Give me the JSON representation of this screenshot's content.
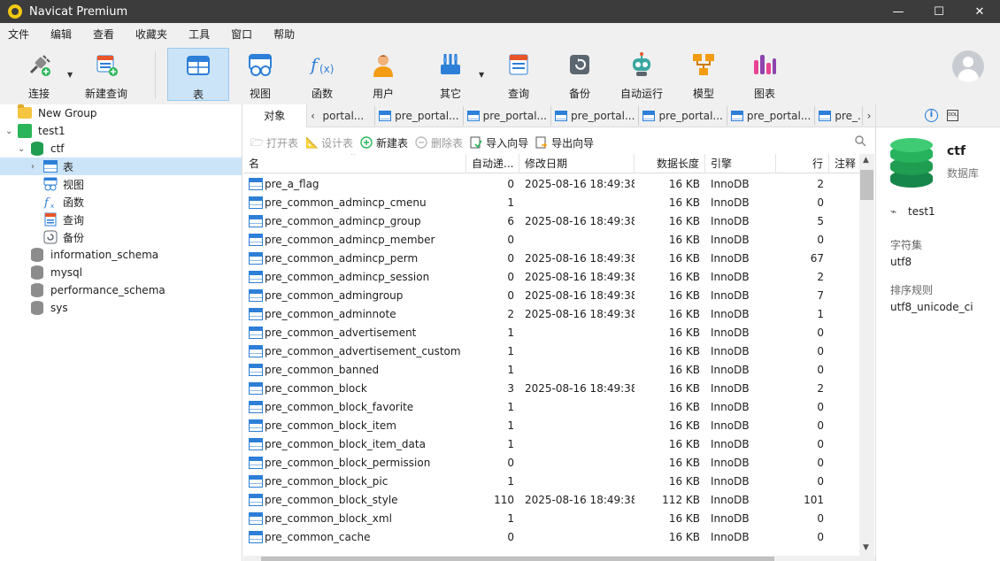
{
  "window": {
    "title": "Navicat Premium",
    "minimize": "—",
    "maximize": "☐",
    "close": "✕"
  },
  "menu": [
    "文件",
    "编辑",
    "查看",
    "收藏夹",
    "工具",
    "窗口",
    "帮助"
  ],
  "toolbar": {
    "connect": "连接",
    "new_query": "新建查询",
    "table": "表",
    "view": "视图",
    "function": "函数",
    "user": "用户",
    "other": "其它",
    "query": "查询",
    "backup": "备份",
    "automation": "自动运行",
    "model": "模型",
    "chart": "图表"
  },
  "sidebar": {
    "group": "New Group",
    "connection": "test1",
    "database": "ctf",
    "db_children": [
      "表",
      "视图",
      "函数",
      "查询",
      "备份"
    ],
    "other_dbs": [
      "information_schema",
      "mysql",
      "performance_schema",
      "sys"
    ]
  },
  "tabs": {
    "object_tab": "对象",
    "open_tabs": [
      "portal...",
      "pre_portal...",
      "pre_portal...",
      "pre_portal...",
      "pre_portal...",
      "pre_portal...",
      "pre_..."
    ]
  },
  "actions": {
    "open_table": "打开表",
    "design_table": "设计表",
    "new_table": "新建表",
    "delete_table": "删除表",
    "import_wizard": "导入向导",
    "export_wizard": "导出向导"
  },
  "table": {
    "headers": [
      "名",
      "自动递...",
      "修改日期",
      "数据长度",
      "引擎",
      "行",
      "注释"
    ],
    "rows": [
      [
        "pre_a_flag",
        "0",
        "2025-08-16 18:49:38",
        "16 KB",
        "InnoDB",
        "2"
      ],
      [
        "pre_common_admincp_cmenu",
        "1",
        "",
        "16 KB",
        "InnoDB",
        "0"
      ],
      [
        "pre_common_admincp_group",
        "6",
        "2025-08-16 18:49:38",
        "16 KB",
        "InnoDB",
        "5"
      ],
      [
        "pre_common_admincp_member",
        "0",
        "",
        "16 KB",
        "InnoDB",
        "0"
      ],
      [
        "pre_common_admincp_perm",
        "0",
        "2025-08-16 18:49:38",
        "16 KB",
        "InnoDB",
        "67"
      ],
      [
        "pre_common_admincp_session",
        "0",
        "2025-08-16 18:49:38",
        "16 KB",
        "InnoDB",
        "2"
      ],
      [
        "pre_common_admingroup",
        "0",
        "2025-08-16 18:49:38",
        "16 KB",
        "InnoDB",
        "7"
      ],
      [
        "pre_common_adminnote",
        "2",
        "2025-08-16 18:49:38",
        "16 KB",
        "InnoDB",
        "1"
      ],
      [
        "pre_common_advertisement",
        "1",
        "",
        "16 KB",
        "InnoDB",
        "0"
      ],
      [
        "pre_common_advertisement_custom",
        "1",
        "",
        "16 KB",
        "InnoDB",
        "0"
      ],
      [
        "pre_common_banned",
        "1",
        "",
        "16 KB",
        "InnoDB",
        "0"
      ],
      [
        "pre_common_block",
        "3",
        "2025-08-16 18:49:38",
        "16 KB",
        "InnoDB",
        "2"
      ],
      [
        "pre_common_block_favorite",
        "1",
        "",
        "16 KB",
        "InnoDB",
        "0"
      ],
      [
        "pre_common_block_item",
        "1",
        "",
        "16 KB",
        "InnoDB",
        "0"
      ],
      [
        "pre_common_block_item_data",
        "1",
        "",
        "16 KB",
        "InnoDB",
        "0"
      ],
      [
        "pre_common_block_permission",
        "0",
        "",
        "16 KB",
        "InnoDB",
        "0"
      ],
      [
        "pre_common_block_pic",
        "1",
        "",
        "16 KB",
        "InnoDB",
        "0"
      ],
      [
        "pre_common_block_style",
        "110",
        "2025-08-16 18:49:38",
        "112 KB",
        "InnoDB",
        "101"
      ],
      [
        "pre_common_block_xml",
        "1",
        "",
        "16 KB",
        "InnoDB",
        "0"
      ],
      [
        "pre_common_cache",
        "0",
        "",
        "16 KB",
        "InnoDB",
        "0"
      ]
    ]
  },
  "info_panel": {
    "name": "ctf",
    "type": "数据库",
    "connection": "test1",
    "charset_label": "字符集",
    "charset": "utf8",
    "collation_label": "排序规则",
    "collation": "utf8_unicode_ci"
  },
  "colors": {
    "accent": "#2d7fd8",
    "selection": "#cce4f7",
    "db_green": "#1f9d50"
  }
}
